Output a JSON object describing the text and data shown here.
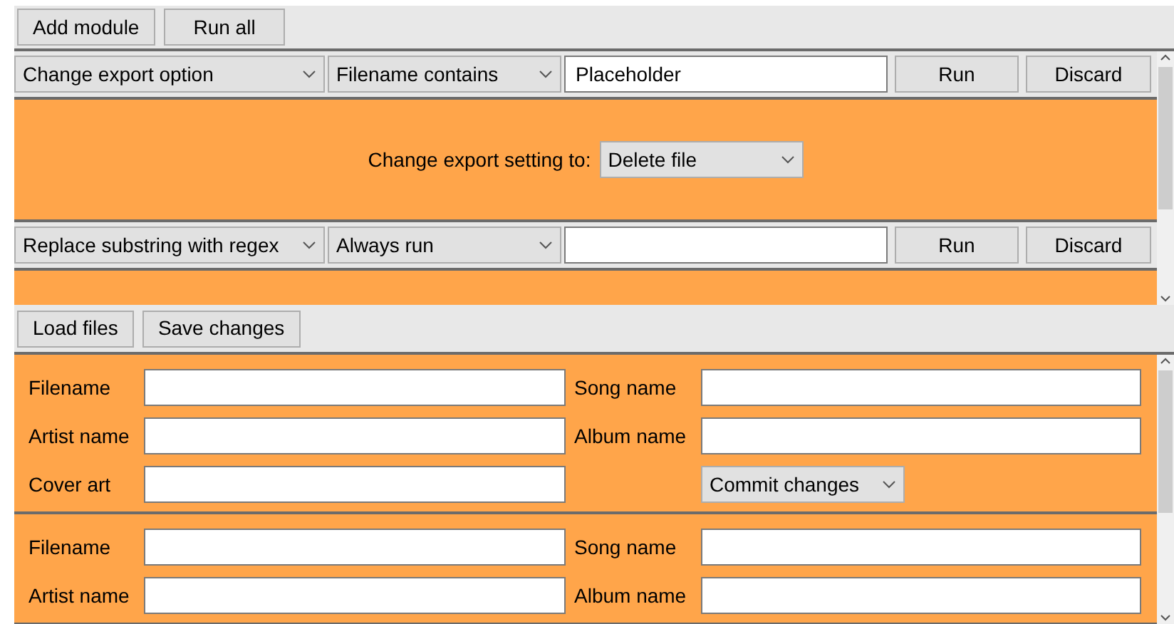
{
  "toolbar": {
    "buttons": [
      "Add module",
      "Run all"
    ]
  },
  "modules": [
    {
      "action": "Change export option",
      "condition": "Filename contains",
      "value": "Placeholder",
      "run_button": "Run",
      "discard_button": "Discard",
      "body": {
        "kind": "setting",
        "label": "Change export setting to:",
        "select": "Delete file"
      }
    },
    {
      "action": "Replace substring with regex",
      "condition": "Always run",
      "run_button": "Run",
      "discard_button": "Discard",
      "body": {
        "kind": "empty"
      }
    }
  ],
  "file_toolbar": {
    "buttons": [
      "Load files",
      "Save changes"
    ]
  },
  "files": [
    {
      "left_fields": [
        {
          "label": "Filename"
        },
        {
          "label": "Artist name"
        },
        {
          "label": "Cover art"
        }
      ],
      "right_fields": [
        {
          "label": "Song name"
        },
        {
          "label": "Album name"
        }
      ],
      "commit_select": "Commit changes"
    },
    {
      "left_fields": [
        {
          "label": "Filename"
        },
        {
          "label": "Artist name"
        }
      ],
      "right_fields": [
        {
          "label": "Song name"
        },
        {
          "label": "Album name"
        }
      ]
    }
  ]
}
